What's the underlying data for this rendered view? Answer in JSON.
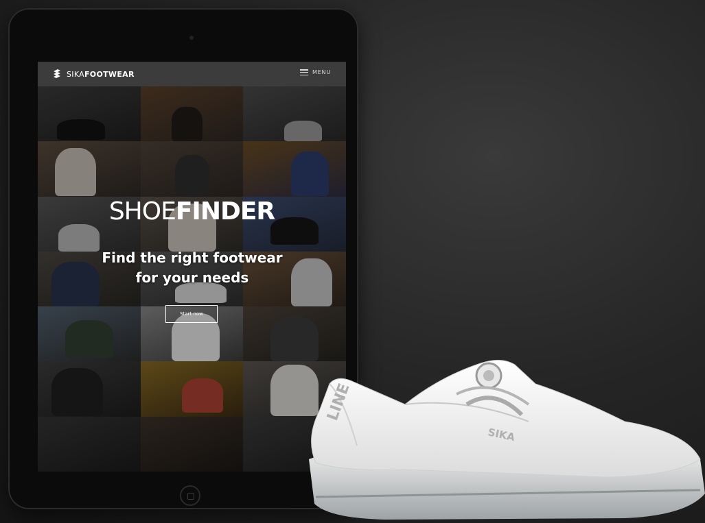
{
  "brand": {
    "name_light": "SIKA",
    "name_bold": "FOOTWEAR"
  },
  "nav": {
    "menu_label": "MENU"
  },
  "hero": {
    "title_light": "SHOE",
    "title_bold": "FINDER",
    "subtitle_line1": "Find the right footwear",
    "subtitle_line2": "for your needs",
    "cta_label": "Start now"
  },
  "shoe": {
    "side_text": "LINE",
    "brand_text": "SIKA"
  },
  "colors": {
    "background": "#252525",
    "navbar": "#3c3c3c",
    "shoe": "#f2f2f2",
    "sole": "#b8bcbf"
  }
}
